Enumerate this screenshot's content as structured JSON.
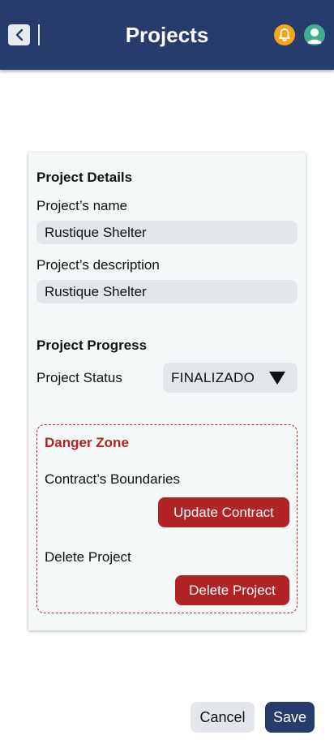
{
  "header": {
    "title": "Projects",
    "back_icon": "chevron-left-icon",
    "notification_icon": "bell-icon",
    "profile_icon": "user-avatar-icon",
    "colors": {
      "bar": "#263c6d",
      "bell": "#f5a71b",
      "avatar": "#3fb08f"
    }
  },
  "project_details": {
    "section_title": "Project Details",
    "name_label": "Project’s name",
    "name_value": "Rustique Shelter",
    "description_label": "Project’s description",
    "description_value": "Rustique Shelter"
  },
  "project_progress": {
    "section_title": "Project Progress",
    "status_label": "Project Status",
    "status_value": "FINALIZADO",
    "status_icon": "triangle-down-icon"
  },
  "danger_zone": {
    "title": "Danger Zone",
    "contract_label": "Contract’s Boundaries",
    "update_button": "Update Contract",
    "delete_label": "Delete Project",
    "delete_button": "Delete Project",
    "accent_color": "#b22327"
  },
  "footer": {
    "cancel_button": "Cancel",
    "save_button": "Save"
  }
}
